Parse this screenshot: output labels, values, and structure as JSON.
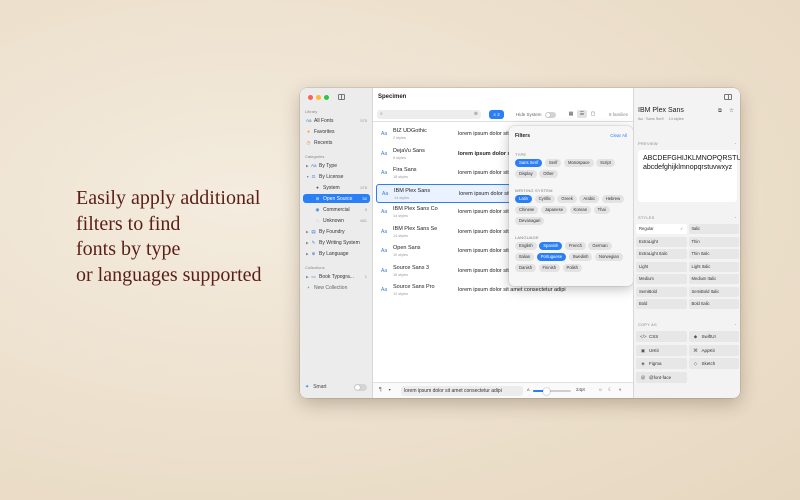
{
  "tagline": [
    "Easily apply additional",
    "filters to find",
    "fonts by type",
    "or languages supported"
  ],
  "sidebar": {
    "library_label": "Library",
    "library": [
      {
        "label": "All Fonts",
        "count": "575",
        "icon": "aa-icon"
      },
      {
        "label": "Favorites",
        "count": "",
        "icon": "star-icon"
      },
      {
        "label": "Recents",
        "count": "",
        "icon": "clock-icon"
      }
    ],
    "categories_label": "Categories",
    "categories": [
      {
        "label": "By Type",
        "icon": "type-icon"
      },
      {
        "label": "By License",
        "icon": "license-icon"
      },
      {
        "label": "System",
        "count": "578",
        "icon": "apple-icon"
      },
      {
        "label": "Open Source",
        "count": "52",
        "icon": "open-source-icon"
      },
      {
        "label": "Commercial",
        "count": "5",
        "icon": "commercial-icon"
      },
      {
        "label": "Unknown",
        "count": "681",
        "icon": "unknown-icon"
      },
      {
        "label": "By Foundry",
        "icon": "foundry-icon"
      },
      {
        "label": "By Writing System",
        "icon": "writing-icon"
      },
      {
        "label": "By Language",
        "icon": "globe-icon"
      }
    ],
    "collections_label": "Collections",
    "collections": [
      {
        "label": "Book Typogra...",
        "count": "1",
        "icon": "folder-icon"
      },
      {
        "label": "New Collection",
        "icon": "plus-icon"
      }
    ],
    "smart_label": "Smart"
  },
  "main": {
    "title": "Specimen",
    "search_placeholder": "",
    "filter_count": "2",
    "hide_system_label": "Hide System",
    "families_count": "8 families",
    "fonts": [
      {
        "name": "BIZ UDGothic",
        "styles": "2 styles",
        "sample": "lorem ipsum dolor sit amet consectetur adipi"
      },
      {
        "name": "DejaVu Sans",
        "styles": "6 styles",
        "sample": "lorem ipsum dolor sit amet consectetur a..."
      },
      {
        "name": "Fira Sans",
        "styles": "18 styles",
        "sample": "lorem ipsum dolor sit amet consectetur adipi"
      },
      {
        "name": "IBM Plex Sans",
        "styles": "14 styles",
        "sample": "lorem ipsum dolor sit amet consectetur adipi"
      },
      {
        "name": "IBM Plex Sans Co",
        "styles": "14 styles",
        "sample": "lorem ipsum dolor sit amet consectetur adipi"
      },
      {
        "name": "IBM Plex Sans Se",
        "styles": "14 styles",
        "sample": "lorem ipsum dolor sit amet consectetur adipi"
      },
      {
        "name": "Open Sans",
        "styles": "10 styles",
        "sample": "lorem ipsum dolor sit amet consectetur adipi"
      },
      {
        "name": "Source Sans 3",
        "styles": "16 styles",
        "sample": "lorem ipsum dolor sit amet consectetur adipi"
      },
      {
        "name": "Source Sans Pro",
        "styles": "12 styles",
        "sample": "lorem ipsum dolor sit amet consectetur adipi"
      }
    ],
    "selected_index": 3,
    "preview_text": "lorem ipsum dolor sit amet consectetur adipi",
    "size_value": "24pt",
    "size_fraction": 0.35
  },
  "filters": {
    "title": "Filters",
    "clear_all": "Clear All",
    "type_label": "TYPE",
    "type": [
      {
        "label": "Sans Serif",
        "on": true
      },
      {
        "label": "Serif",
        "on": false
      },
      {
        "label": "Monospace",
        "on": false
      },
      {
        "label": "Script",
        "on": false
      },
      {
        "label": "Display",
        "on": false
      },
      {
        "label": "Other",
        "on": false
      }
    ],
    "writing_label": "WRITING SYSTEM",
    "writing": [
      {
        "label": "Latin",
        "on": true
      },
      {
        "label": "Cyrillic",
        "on": false
      },
      {
        "label": "Greek",
        "on": false
      },
      {
        "label": "Arabic",
        "on": false
      },
      {
        "label": "Hebrew",
        "on": false
      },
      {
        "label": "Chinese",
        "on": false
      },
      {
        "label": "Japanese",
        "on": false
      },
      {
        "label": "Korean",
        "on": false
      },
      {
        "label": "Thai",
        "on": false
      },
      {
        "label": "Devanagari",
        "on": false
      }
    ],
    "language_label": "LANGUAGE",
    "language": [
      {
        "label": "English",
        "on": false
      },
      {
        "label": "Spanish",
        "on": true
      },
      {
        "label": "French",
        "on": false
      },
      {
        "label": "German",
        "on": false
      },
      {
        "label": "Italian",
        "on": false
      },
      {
        "label": "Portuguese",
        "on": true
      },
      {
        "label": "Swedish",
        "on": false
      },
      {
        "label": "Norwegian",
        "on": false
      },
      {
        "label": "Danish",
        "on": false
      },
      {
        "label": "Finnish",
        "on": false
      },
      {
        "label": "Polish",
        "on": false
      }
    ]
  },
  "inspector": {
    "title": "IBM Plex Sans",
    "subtitle_type": "Aa · Sans Serif",
    "subtitle_styles": "14 styles",
    "preview_label": "PREVIEW",
    "preview_text": "ABCDEFGHIJKLMNOPQRSTUVWXYZ abcdefghijklmnopqrstuvwxyz",
    "styles_label": "STYLES",
    "styles": [
      "Regular",
      "Italic",
      "ExtraLight",
      "Thin",
      "ExtraLight Italic",
      "Thin Italic",
      "Light",
      "Light Italic",
      "Medium",
      "Medium Italic",
      "SemiBold",
      "SemiBold Italic",
      "Bold",
      "Bold Italic"
    ],
    "selected_style": 0,
    "copy_label": "COPY AS",
    "copy_as": [
      {
        "label": "CSS",
        "icon": "code-icon"
      },
      {
        "label": "SwiftUI",
        "icon": "swift-icon"
      },
      {
        "label": "UIKit",
        "icon": "uikit-icon"
      },
      {
        "label": "AppKit",
        "icon": "appkit-icon"
      },
      {
        "label": "Figma",
        "icon": "figma-icon"
      },
      {
        "label": "Sketch",
        "icon": "sketch-icon"
      },
      {
        "label": "@font-face",
        "icon": "font-face-icon"
      }
    ]
  },
  "colors": {
    "accent": "#2b7ff6",
    "tagline": "#5a1f17",
    "background": "#efe4d3"
  }
}
